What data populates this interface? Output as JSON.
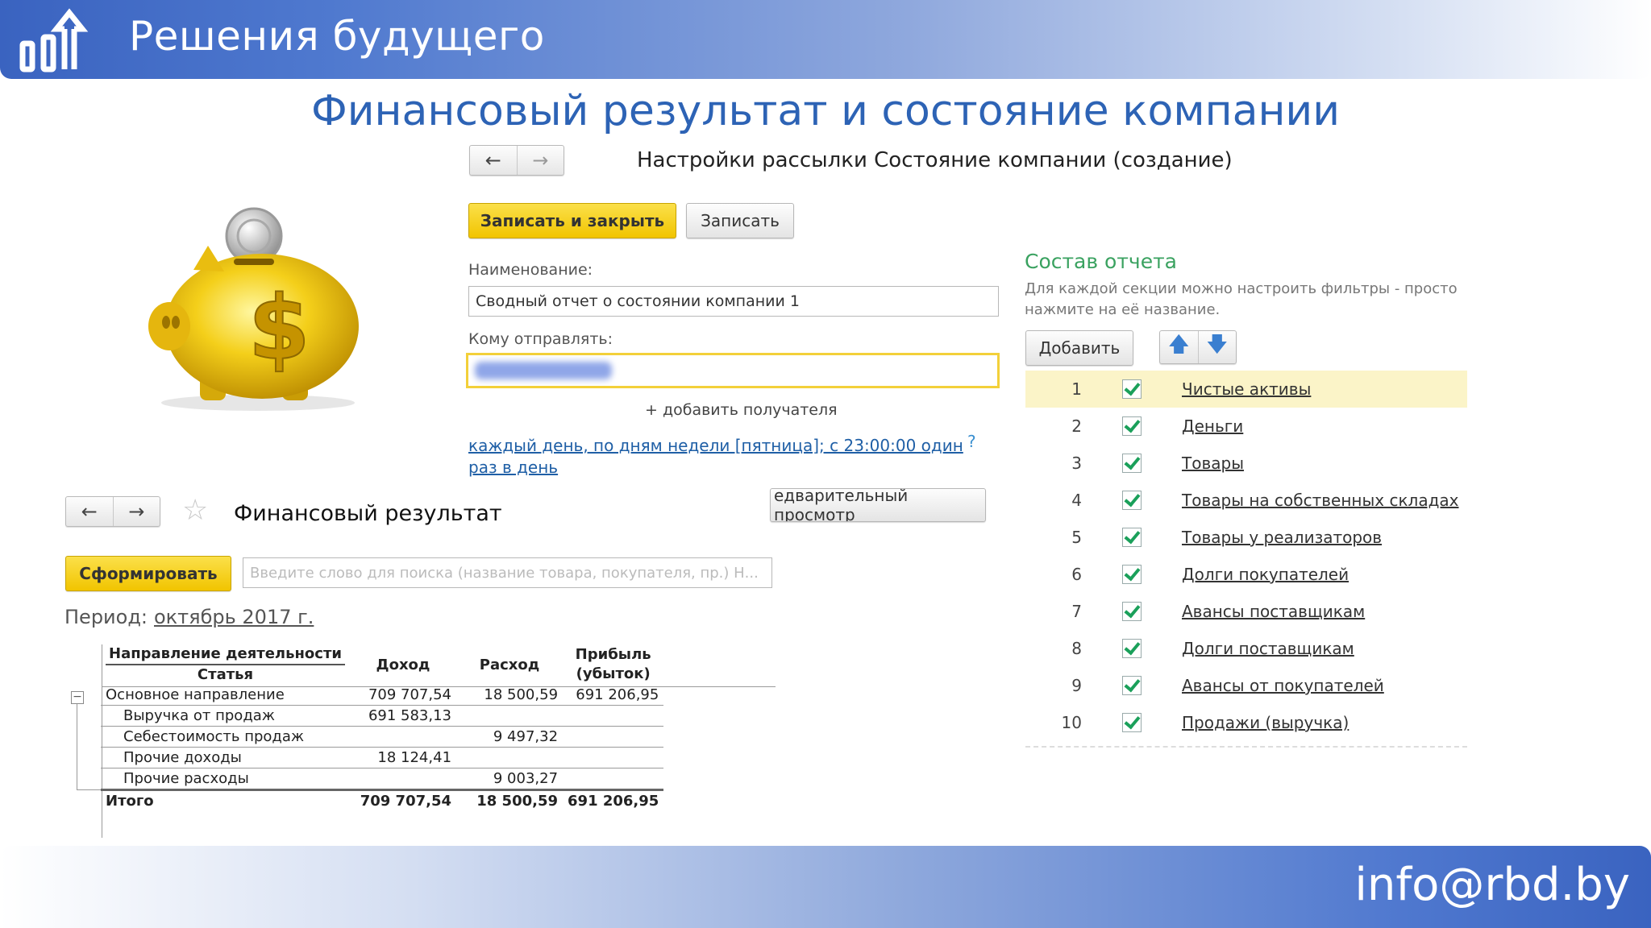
{
  "brand": {
    "name": "Решения будущего",
    "email": "info@rbd.by"
  },
  "slide_title": "Финансовый результат и состояние компании",
  "settings": {
    "window_title": "Настройки рассылки Состояние компании (создание)",
    "save_close_label": "Записать и закрыть",
    "save_label": "Записать",
    "name_label": "Наименование:",
    "name_value": "Сводный отчет о состоянии компании 1",
    "recipients_label": "Кому отправлять:",
    "add_recipient": "+ добавить получателя",
    "schedule_link": "каждый день, по дням недели [пятница]; с 23:00:00 один раз в день",
    "help": "?",
    "preview_label": "едварительный просмотр",
    "composition_title": "Состав отчета",
    "composition_hint": "Для каждой секции можно настроить фильтры - просто нажмите на её название.",
    "add_label": "Добавить",
    "sections": [
      {
        "n": "1",
        "name": "Чистые активы",
        "checked": true
      },
      {
        "n": "2",
        "name": "Деньги",
        "checked": true
      },
      {
        "n": "3",
        "name": "Товары",
        "checked": true
      },
      {
        "n": "4",
        "name": "Товары на собственных складах",
        "checked": true
      },
      {
        "n": "5",
        "name": "Товары у реализаторов",
        "checked": true
      },
      {
        "n": "6",
        "name": "Долги покупателей",
        "checked": true
      },
      {
        "n": "7",
        "name": "Авансы поставщикам",
        "checked": true
      },
      {
        "n": "8",
        "name": "Долги поставщикам",
        "checked": true
      },
      {
        "n": "9",
        "name": "Авансы от покупателей",
        "checked": true
      },
      {
        "n": "10",
        "name": "Продажи (выручка)",
        "checked": true
      }
    ]
  },
  "report": {
    "title": "Финансовый результат",
    "generate_label": "Сформировать",
    "search_placeholder": "Введите слово для поиска (название товара, покупателя, пр.) Н...",
    "period_label": "Период:",
    "period_value": "октябрь 2017 г.",
    "headers": {
      "direction": "Направление деятельности",
      "article": "Статья",
      "income": "Доход",
      "expense": "Расход",
      "profit": "Прибыль (убыток)"
    },
    "rows": [
      {
        "name": "Основное направление",
        "income": "709 707,54",
        "expense": "18 500,59",
        "profit": "691 206,95"
      },
      {
        "name": "Выручка от продаж",
        "income": "691 583,13",
        "expense": "",
        "profit": ""
      },
      {
        "name": "Себестоимость продаж",
        "income": "",
        "expense": "9 497,32",
        "profit": ""
      },
      {
        "name": "Прочие доходы",
        "income": "18 124,41",
        "expense": "",
        "profit": ""
      },
      {
        "name": "Прочие расходы",
        "income": "",
        "expense": "9 003,27",
        "profit": ""
      }
    ],
    "total": {
      "name": "Итого",
      "income": "709 707,54",
      "expense": "18 500,59",
      "profit": "691 206,95"
    }
  }
}
